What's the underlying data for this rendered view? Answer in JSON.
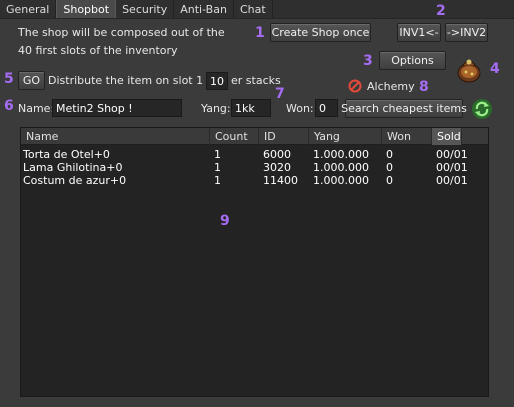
{
  "tabs": [
    "General",
    "Shopbot",
    "Security",
    "Anti-Ban",
    "Chat"
  ],
  "active_tab": "Shopbot",
  "info": {
    "line1": "The shop will be composed out of the",
    "line2": "40 first slots of the inventory"
  },
  "buttons": {
    "create_shop_once": "Create Shop once",
    "inv1": "INV1<-",
    "inv2": "->INV2",
    "options": "Options",
    "go": "GO",
    "search_cheapest": "Search cheapest items"
  },
  "distribute": {
    "prefix": "Distribute the item on slot 1 into",
    "count": "10",
    "suffix": "er stacks"
  },
  "alchemy": {
    "label": "Alchemy"
  },
  "form": {
    "name_label": "Name:",
    "name_value": "Metin2 Shop !",
    "yang_label": "Yang:",
    "yang_value": "1kk",
    "won_label": "Won:",
    "won_value": "0"
  },
  "markers": [
    "1",
    "2",
    "3",
    "4",
    "5",
    "6",
    "7",
    "8",
    "9"
  ],
  "table": {
    "columns": [
      "Name",
      "Count",
      "ID",
      "Yang",
      "Won",
      "Sold"
    ],
    "rows": [
      [
        "Torta de Otel+0",
        "1",
        "6000",
        "1.000.000",
        "0",
        "00/01"
      ],
      [
        "Lama Ghilotina+0",
        "1",
        "3020",
        "1.000.000",
        "0",
        "00/01"
      ],
      [
        "Costum de azur+0",
        "1",
        "11400",
        "1.000.000",
        "0",
        "00/01"
      ]
    ]
  },
  "colors": {
    "marker": "#a56df2",
    "alchemy_icon": "#e24a3a",
    "refresh_icon": "#3fbf3a"
  }
}
